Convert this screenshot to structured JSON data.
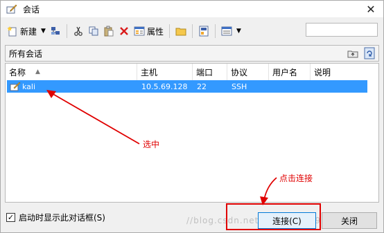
{
  "window": {
    "title": "会话"
  },
  "toolbar": {
    "new_label": "新建",
    "properties_label": "属性",
    "search_placeholder": ""
  },
  "pathbar": {
    "label": "所有会话"
  },
  "list": {
    "columns": [
      "名称",
      "主机",
      "端口",
      "协议",
      "用户名",
      "说明"
    ],
    "rows": [
      {
        "name": "kali",
        "host": "10.5.69.128",
        "port": "22",
        "protocol": "SSH",
        "username": "",
        "description": ""
      }
    ]
  },
  "footer": {
    "show_at_startup_label": "启动时显示此对话框(S)",
    "show_at_startup_checked": true,
    "connect_label": "连接(C)",
    "close_label": "关闭"
  },
  "annotations": {
    "select_note": "选中",
    "connect_note": "点击连接"
  },
  "watermark": "//blog.csdn.net/qq_34427097",
  "colors": {
    "selection": "#3399ff",
    "annotation": "#e00000"
  }
}
